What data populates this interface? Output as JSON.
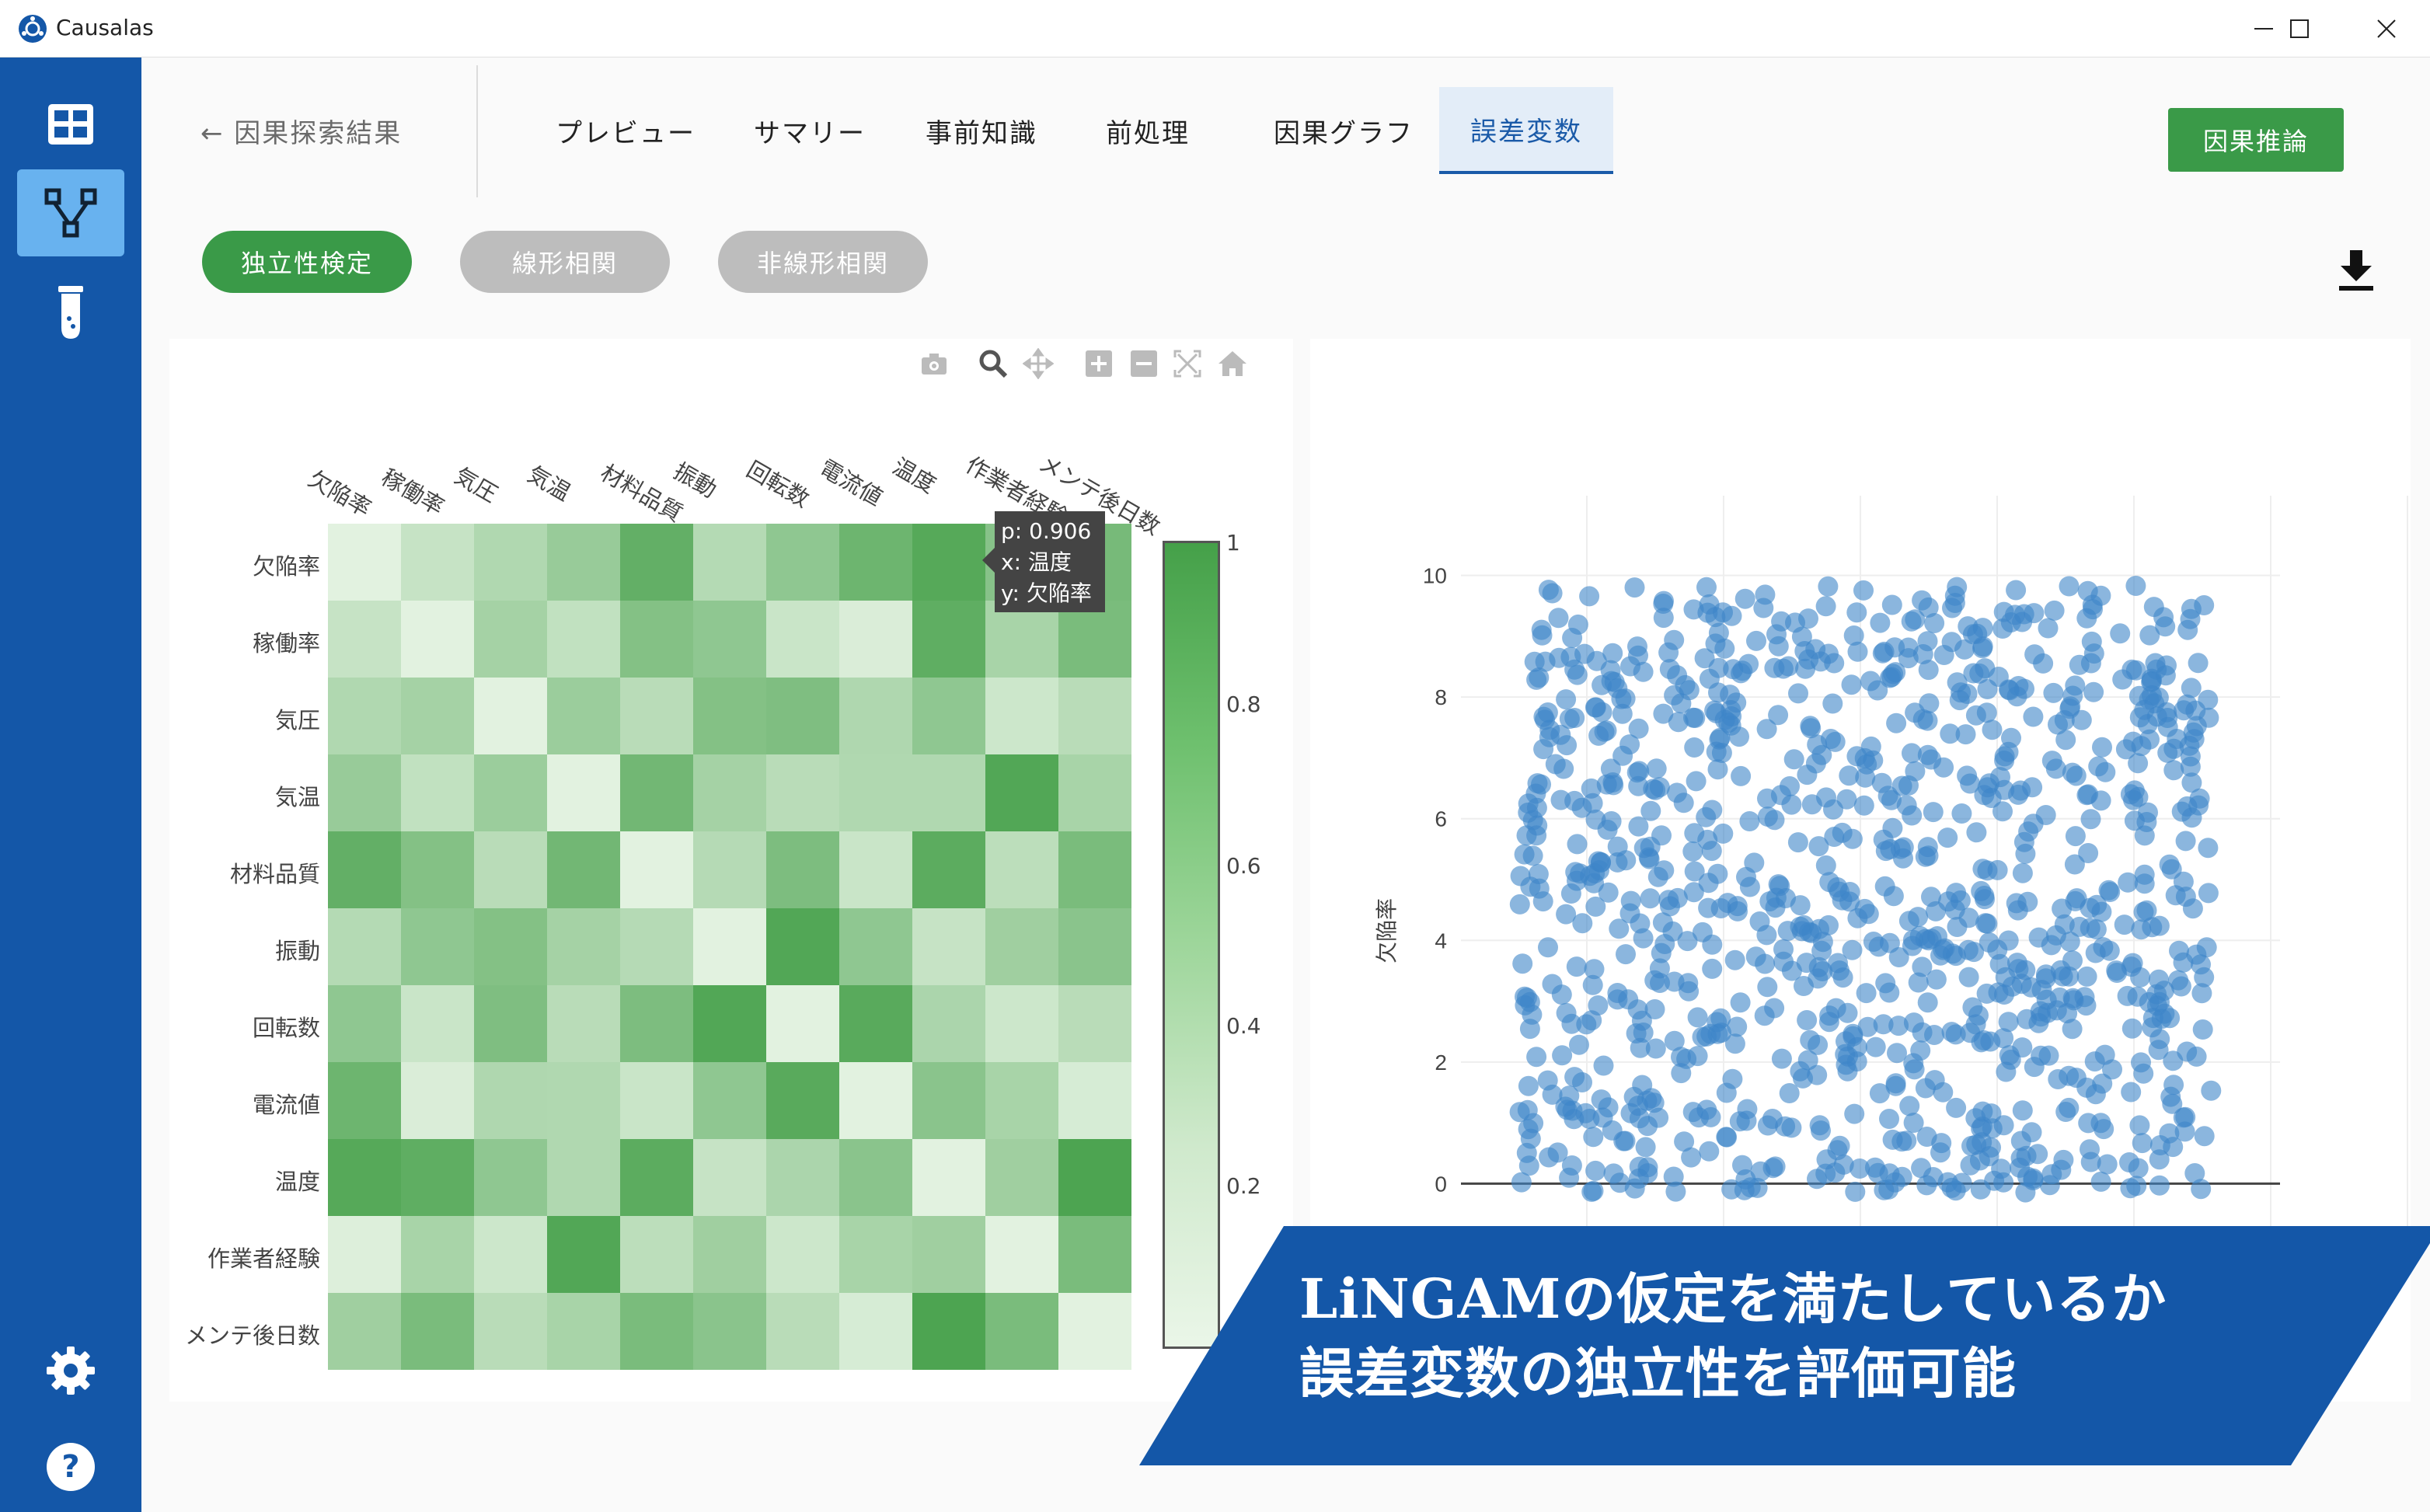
{
  "window": {
    "title": "Causalas",
    "controls": [
      "minimize",
      "maximize",
      "close"
    ]
  },
  "sidebar": {
    "items": [
      {
        "icon": "grid-icon",
        "active": false
      },
      {
        "icon": "graph-branch-icon",
        "active": true
      },
      {
        "icon": "test-tube-icon",
        "active": false
      }
    ],
    "bottom_items": [
      {
        "icon": "gear-icon"
      },
      {
        "icon": "help-icon"
      }
    ]
  },
  "header": {
    "back_label": "← 因果探索結果",
    "tabs": [
      {
        "label": "プレビュー",
        "active": false
      },
      {
        "label": "サマリー",
        "active": false
      },
      {
        "label": "事前知識",
        "active": false
      },
      {
        "label": "前処理",
        "active": false
      },
      {
        "label": "因果グラフ",
        "active": false
      },
      {
        "label": "誤差変数",
        "active": true
      }
    ],
    "primary_action": "因果推論"
  },
  "chips": [
    {
      "label": "独立性検定",
      "active": true
    },
    {
      "label": "線形相関",
      "active": false
    },
    {
      "label": "非線形相関",
      "active": false
    }
  ],
  "toolbar_icons": [
    "camera-icon",
    "zoom-icon",
    "pan-icon",
    "zoom-in-icon",
    "zoom-out-icon",
    "autoscale-icon",
    "home-icon"
  ],
  "heatmap": {
    "labels": [
      "欠陥率",
      "稼働率",
      "気圧",
      "気温",
      "材料品質",
      "振動",
      "回転数",
      "電流値",
      "温度",
      "作業者経験",
      "メンテ後日数"
    ],
    "tooltip": {
      "p": "p: 0.906",
      "x": "x: 温度",
      "y": "y: 欠陥率"
    },
    "colorbar_ticks": [
      "1",
      "0.8",
      "0.6",
      "0.4",
      "0.2"
    ],
    "colorscale": [
      "#eaf6e8",
      "#45a049"
    ],
    "values": [
      [
        0.05,
        0.22,
        0.35,
        0.5,
        0.82,
        0.33,
        0.55,
        0.76,
        0.9,
        0.6,
        0.7
      ],
      [
        0.22,
        0.05,
        0.42,
        0.25,
        0.62,
        0.55,
        0.2,
        0.1,
        0.84,
        0.4,
        0.68
      ],
      [
        0.35,
        0.42,
        0.05,
        0.48,
        0.3,
        0.62,
        0.65,
        0.36,
        0.55,
        0.18,
        0.3
      ],
      [
        0.5,
        0.25,
        0.48,
        0.05,
        0.73,
        0.42,
        0.3,
        0.35,
        0.35,
        0.92,
        0.4
      ],
      [
        0.82,
        0.62,
        0.3,
        0.73,
        0.05,
        0.32,
        0.66,
        0.2,
        0.86,
        0.28,
        0.68
      ],
      [
        0.33,
        0.55,
        0.62,
        0.42,
        0.32,
        0.05,
        0.92,
        0.55,
        0.22,
        0.45,
        0.58
      ],
      [
        0.55,
        0.2,
        0.65,
        0.3,
        0.66,
        0.92,
        0.05,
        0.88,
        0.38,
        0.18,
        0.3
      ],
      [
        0.76,
        0.1,
        0.36,
        0.35,
        0.2,
        0.55,
        0.88,
        0.05,
        0.58,
        0.4,
        0.12
      ],
      [
        0.9,
        0.84,
        0.55,
        0.35,
        0.86,
        0.22,
        0.38,
        0.58,
        0.05,
        0.45,
        0.95
      ],
      [
        0.08,
        0.4,
        0.18,
        0.92,
        0.28,
        0.45,
        0.18,
        0.4,
        0.45,
        0.05,
        0.68
      ],
      [
        0.45,
        0.68,
        0.3,
        0.4,
        0.68,
        0.58,
        0.3,
        0.12,
        0.95,
        0.68,
        0.05
      ]
    ]
  },
  "chart_data": {
    "type": "scatter",
    "title": "",
    "xlabel": "",
    "ylabel": "欠陥率",
    "ylim": [
      -0.8,
      10.8
    ],
    "yticks": [
      "10",
      "8",
      "6",
      "4",
      "2",
      "0"
    ],
    "x_range_hint": [
      -5,
      20
    ],
    "point_count_estimate": 1000,
    "marker_color": "#3d86c8",
    "marker_opacity": 0.6,
    "grid": true,
    "note_points": "uniform random cloud of points with y from 0 to 10 across the visible x range"
  },
  "banner": {
    "line1": "LiNGAMの仮定を満たしているか",
    "line2": "誤差変数の独立性を評価可能",
    "color": "#1457a8"
  }
}
